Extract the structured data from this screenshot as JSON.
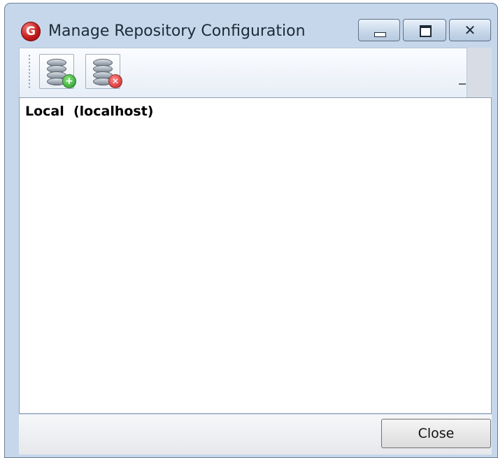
{
  "window": {
    "title": "Manage Repository Configuration",
    "app_icon_letter": "G",
    "controls": {
      "minimize_icon": "minimize-icon",
      "maximize_icon": "maximize-icon",
      "close_glyph": "✕"
    }
  },
  "toolbar": {
    "buttons": [
      {
        "name": "add-repository",
        "icon": "database-add-icon"
      },
      {
        "name": "remove-repository",
        "icon": "database-remove-icon"
      }
    ]
  },
  "repositories": [
    {
      "label": "Local  (localhost)"
    }
  ],
  "footer": {
    "close_label": "Close"
  },
  "colors": {
    "frame": "#c6d7eb",
    "add_badge": "#1d9b25",
    "remove_badge": "#c81d1d"
  }
}
